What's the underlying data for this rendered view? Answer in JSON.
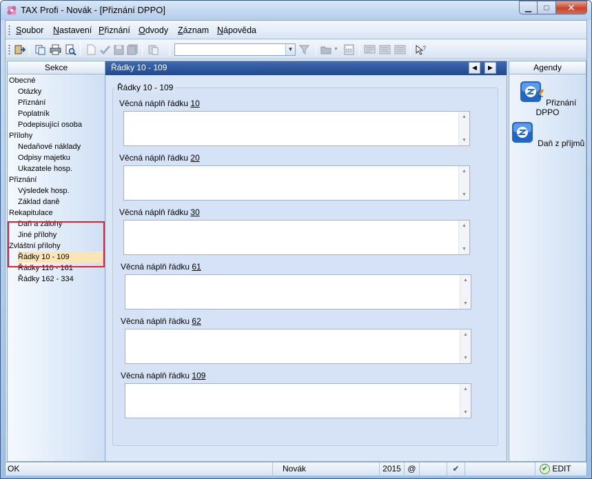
{
  "window": {
    "title": "TAX Profi - Novák - [Přiznání DPPO]"
  },
  "menu": [
    {
      "label": "Soubor",
      "accel": "S",
      "rest": "oubor"
    },
    {
      "label": "Nastavení",
      "accel": "N",
      "rest": "astavení"
    },
    {
      "label": "Přiznání",
      "accel": "P",
      "rest": "řiznání"
    },
    {
      "label": "Odvody",
      "accel": "O",
      "rest": "dvody"
    },
    {
      "label": "Záznam",
      "accel": "Z",
      "rest": "áznam"
    },
    {
      "label": "Nápověda",
      "accel": "N",
      "rest": "ápověda"
    }
  ],
  "toolbar": {
    "combo_value": ""
  },
  "sections": {
    "header": "Sekce",
    "items": [
      {
        "label": "Obecné",
        "level": 0,
        "selected": false
      },
      {
        "label": "Otázky",
        "level": 1,
        "selected": false
      },
      {
        "label": "Přiznání",
        "level": 1,
        "selected": false
      },
      {
        "label": "Poplatník",
        "level": 1,
        "selected": false
      },
      {
        "label": "Podepisující osoba",
        "level": 1,
        "selected": false
      },
      {
        "label": "Přílohy",
        "level": 0,
        "selected": false
      },
      {
        "label": "Nedaňové náklady",
        "level": 1,
        "selected": false
      },
      {
        "label": "Odpisy majetku",
        "level": 1,
        "selected": false
      },
      {
        "label": "Ukazatele hosp.",
        "level": 1,
        "selected": false
      },
      {
        "label": "Přiznání",
        "level": 0,
        "selected": false
      },
      {
        "label": "Výsledek hosp.",
        "level": 1,
        "selected": false
      },
      {
        "label": "Základ daně",
        "level": 1,
        "selected": false
      },
      {
        "label": "Rekapitulace",
        "level": 0,
        "selected": false
      },
      {
        "label": "Daň a zálohy",
        "level": 1,
        "selected": false
      },
      {
        "label": "Jiné přílohy",
        "level": 1,
        "selected": false
      },
      {
        "label": "Zvláštní přílohy",
        "level": 0,
        "selected": false
      },
      {
        "label": "Řádky 10 - 109",
        "level": 1,
        "selected": true
      },
      {
        "label": "Řádky 110 - 161",
        "level": 1,
        "selected": false
      },
      {
        "label": "Řádky 162 - 334",
        "level": 1,
        "selected": false
      }
    ]
  },
  "main": {
    "header": "Řádky 10 - 109",
    "group_title": "Řádky 10 - 109",
    "fields": [
      {
        "prefix": "Věcná náplň řádku",
        "number": "10",
        "value": ""
      },
      {
        "prefix": "Věcná náplň řádku",
        "number": "20",
        "value": ""
      },
      {
        "prefix": "Věcná náplň řádku",
        "number": "30",
        "value": ""
      },
      {
        "prefix": "Věcná náplň řádku",
        "number": "61",
        "value": ""
      },
      {
        "prefix": "Věcná náplň řádku",
        "number": "62",
        "value": ""
      },
      {
        "prefix": "Věcná náplň řádku",
        "number": "109",
        "value": ""
      }
    ]
  },
  "agendy": {
    "header": "Agendy",
    "items": [
      {
        "label": "Přiznání DPPO",
        "icon": "dppo-icon"
      },
      {
        "label": "Daň z příjmů",
        "icon": "dan-icon"
      }
    ]
  },
  "statusbar": {
    "status": "OK",
    "user": "Novák",
    "year": "2015",
    "at": "@",
    "mode": "EDIT"
  }
}
